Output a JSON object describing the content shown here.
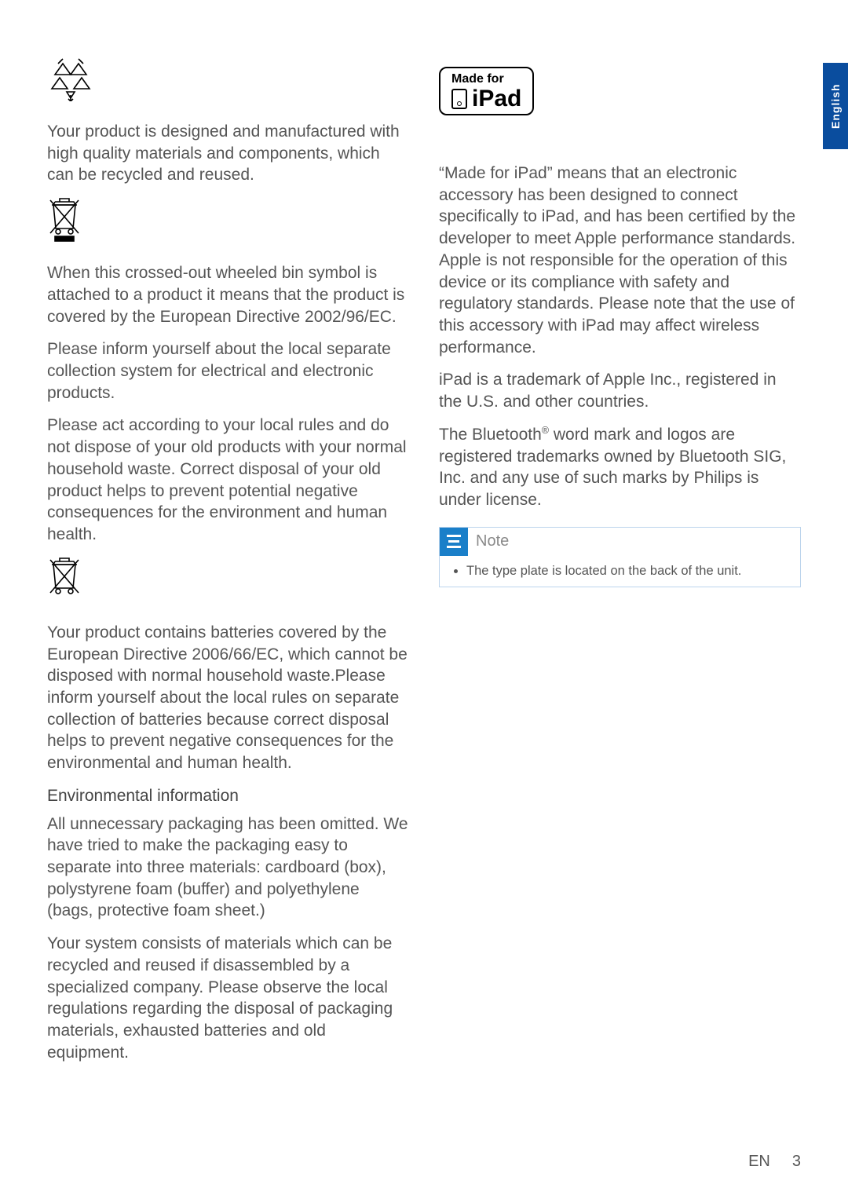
{
  "sideTab": "English",
  "left": {
    "p1": "Your product is designed and manufactured with high quality materials and components, which can be recycled and reused.",
    "p2": "When this crossed-out wheeled bin symbol is attached to a product it means that the product is covered by the European Directive 2002/96/EC.",
    "p3": "Please inform yourself about the local separate collection system for electrical and electronic products.",
    "p4": "Please act according to your local rules and do not dispose of your old products with your normal household waste. Correct disposal of your old product helps to prevent potential negative consequences for the environment and human health.",
    "p5": "Your product contains batteries covered by the European Directive 2006/66/EC, which cannot be disposed with normal household waste.Please inform yourself about the local rules on separate collection of batteries because correct disposal helps to prevent negative consequences for the environmental and human health.",
    "h1": "Environmental information",
    "p6": "All unnecessary packaging has been omitted. We have tried to make the packaging easy to separate into three materials: cardboard (box), polystyrene foam (buffer) and polyethylene (bags, protective foam sheet.)",
    "p7": "Your system consists of materials which can be recycled and reused if disassembled by a specialized company. Please observe the local regulations regarding the disposal of packaging materials, exhausted batteries and old equipment."
  },
  "right": {
    "badge": {
      "madeFor": "Made for",
      "ipad": "iPad"
    },
    "p1": "“Made for iPad” means that an electronic accessory has been designed to connect specifically to iPad, and has been certified by the developer to meet Apple performance standards. Apple is not responsible for the operation of this device or its compliance with safety and regulatory standards. Please note that the use of this accessory with iPad may affect wireless performance.",
    "p2": "iPad is a trademark of Apple Inc., registered in the U.S. and other countries.",
    "p3_a": "The Bluetooth",
    "p3_b": " word mark and logos are registered trademarks owned by Bluetooth SIG, Inc. and any use of such marks by Philips is under license.",
    "note": {
      "title": "Note",
      "item1": "The type plate is located on the back of the unit."
    }
  },
  "footer": {
    "lang": "EN",
    "page": "3"
  }
}
